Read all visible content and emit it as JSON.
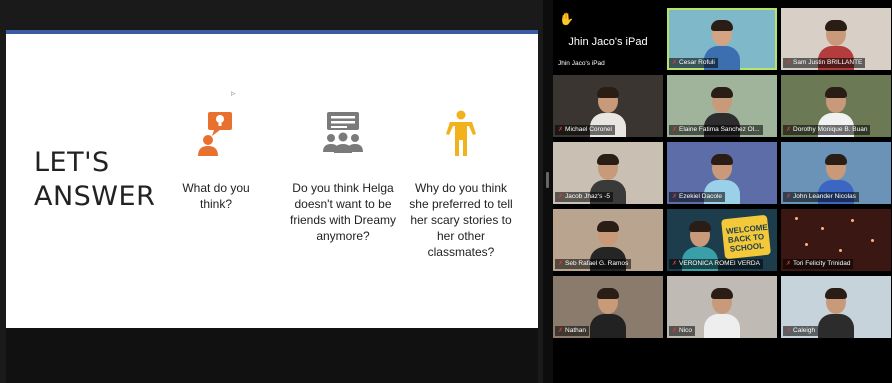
{
  "slide": {
    "title_line1": "LET'S",
    "title_line2": "ANSWER",
    "questions": [
      {
        "icon": "speaker-idea-icon",
        "text": "What do you think?"
      },
      {
        "icon": "group-discussion-icon",
        "text": "Do you think Helga doesn't want to be friends with Dreamy anymore?"
      },
      {
        "icon": "person-standing-icon",
        "text": "Why do you think she preferred to tell her scary stories to her other classmates?"
      }
    ],
    "accent_color": "#3b5ba5",
    "icon_colors": {
      "orange": "#e8712f",
      "gray": "#7a7a7a",
      "gold": "#f2b21b"
    }
  },
  "gallery": {
    "raised_hand_tile": {
      "big_name": "Jhin Jaco's iPad",
      "label": "Jhin Jaco's iPad"
    },
    "participants": [
      {
        "id": "cesar",
        "name": "Cesar Rofuli"
      },
      {
        "id": "sam",
        "name": "Sam Justin BRILLANTE"
      },
      {
        "id": "michael",
        "name": "Michael Coronel"
      },
      {
        "id": "elaine",
        "name": "Elaine Fatima Sanchez Ol..."
      },
      {
        "id": "dorothy",
        "name": "Dorothy Monique B. Buan"
      },
      {
        "id": "jacob",
        "name": "Jacob Jhaz's -5"
      },
      {
        "id": "ezekiel",
        "name": "Ezekiel Dacole"
      },
      {
        "id": "john",
        "name": "John Leander Nicolas"
      },
      {
        "id": "seb",
        "name": "Seb Rafael G. Ramos"
      },
      {
        "id": "veronica",
        "name": "VERONICA ROMEI VERDA"
      },
      {
        "id": "tori",
        "name": "Tori Felicity Trinidad"
      },
      {
        "id": "nathan",
        "name": "Nathan"
      },
      {
        "id": "nico",
        "name": "Nico"
      },
      {
        "id": "caleigh",
        "name": "Caleigh"
      }
    ],
    "veronica_background_text": "WELCOME BACK TO SCHOOL",
    "active_speaker_color": "#b7e36a",
    "muted_icon_color": "#e23b3b"
  }
}
